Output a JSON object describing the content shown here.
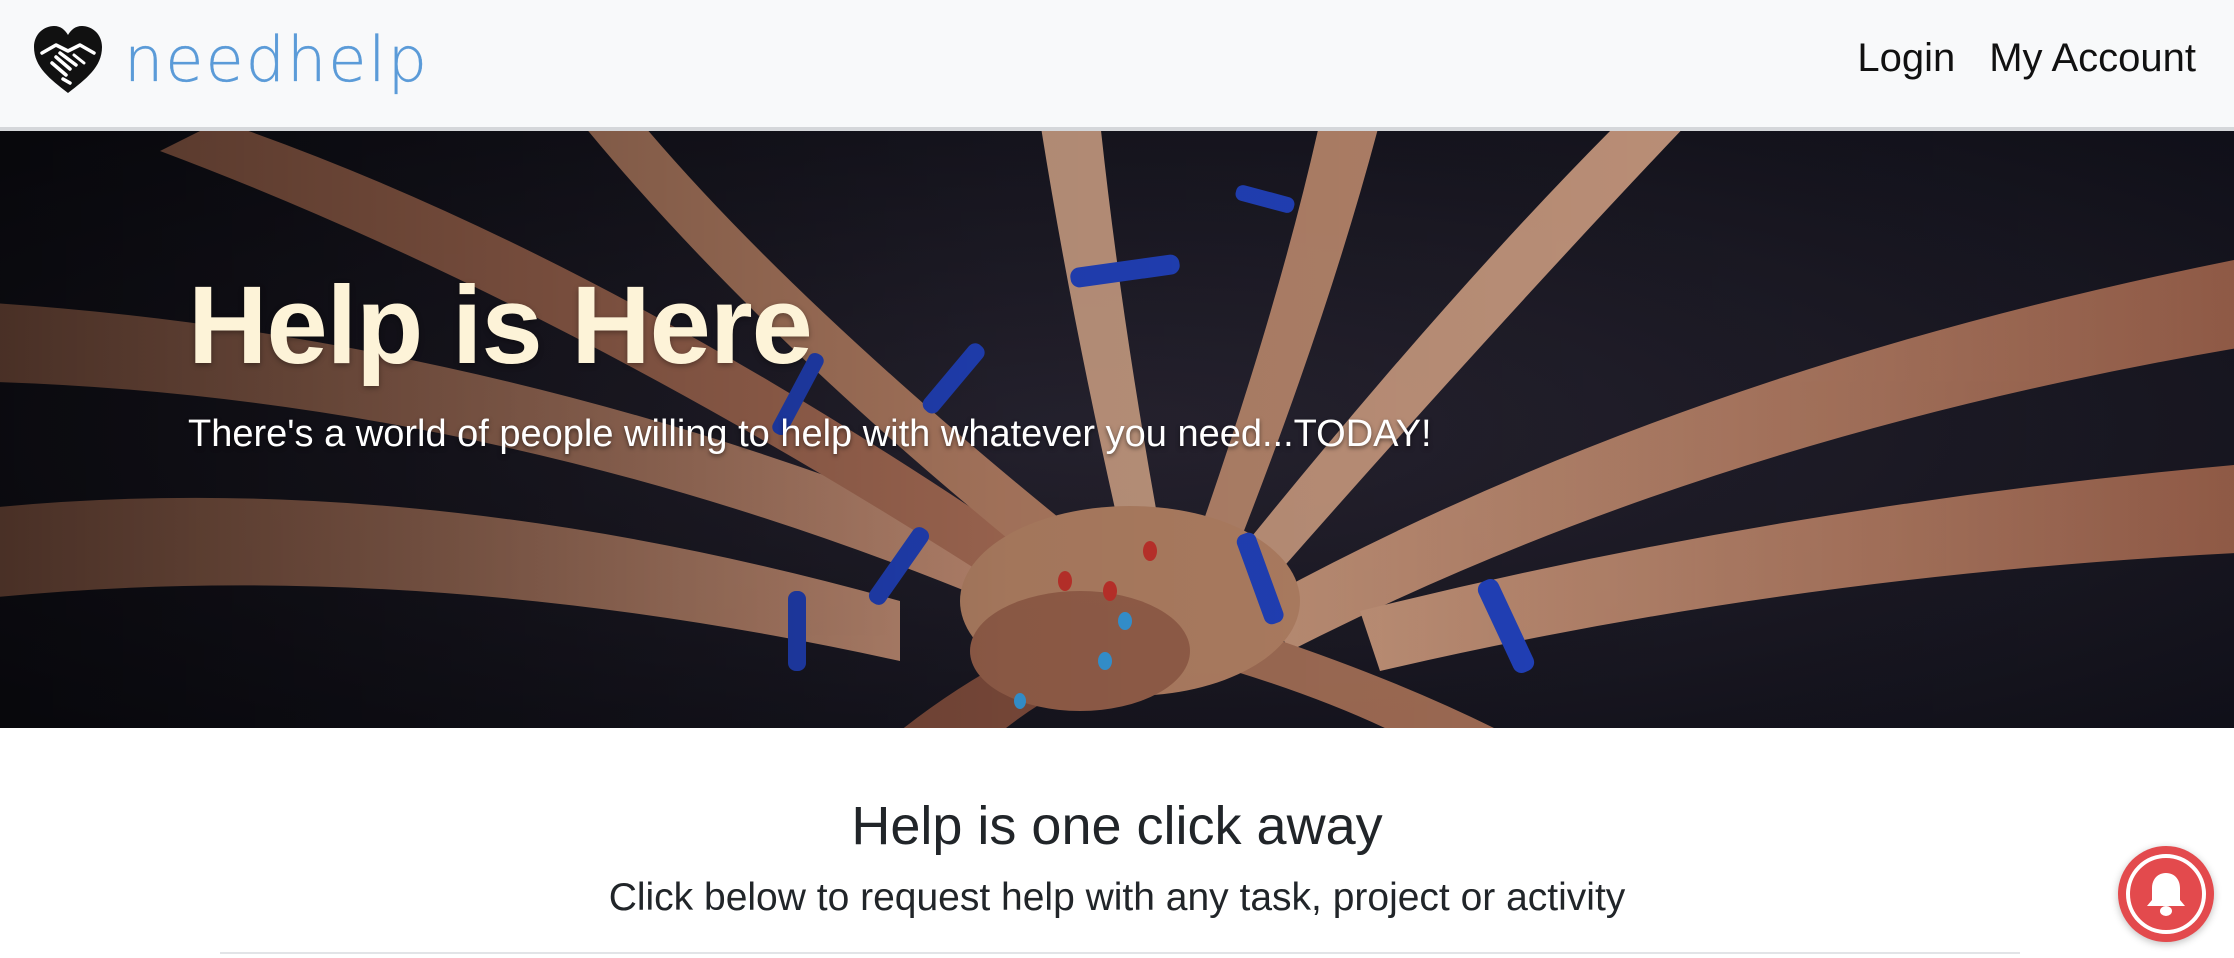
{
  "brand": {
    "name": "needhelp",
    "logo_icon": "heart-handshake-icon",
    "color": "#5b9bd8"
  },
  "nav": {
    "items": [
      {
        "label": "Login"
      },
      {
        "label": "My Account"
      }
    ]
  },
  "hero": {
    "title": "Help is Here",
    "subtitle": "There's a world of people willing to help with whatever you need...TODAY!",
    "image": "stacked-hands-photo",
    "title_color": "#fdf3d8"
  },
  "section": {
    "title": "Help is one click away",
    "subtitle": "Click below to request help with any task, project or activity"
  },
  "notification": {
    "icon": "bell-icon",
    "color": "#e34a4d"
  }
}
